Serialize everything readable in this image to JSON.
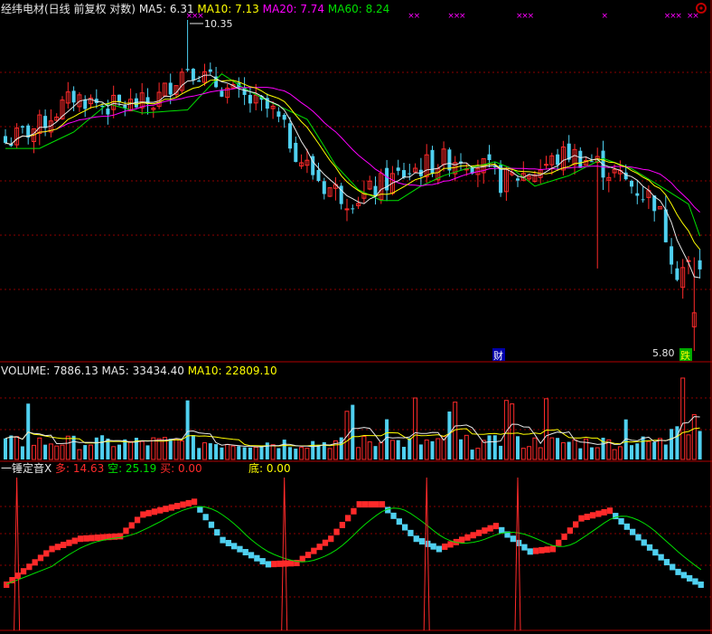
{
  "colors": {
    "background": "#000000",
    "up": "#ff2a2a",
    "down": "#4fd0f0",
    "ma5": "#e8e8e8",
    "ma10": "#ffff00",
    "ma20": "#ff00ff",
    "ma60": "#00e000",
    "grid": "#8b0000",
    "panel_border": "#b00000",
    "trade_fill": "#0000aa"
  },
  "main_panel": {
    "title": "经纬电材(日线 前复权 对数)",
    "legend": [
      {
        "label": "MA5",
        "value": "6.31",
        "color": "#e8e8e8"
      },
      {
        "label": "MA10",
        "value": "7.13",
        "color": "#ffff00"
      },
      {
        "label": "MA20",
        "value": "7.74",
        "color": "#ff00ff"
      },
      {
        "label": "MA60",
        "value": "8.24",
        "color": "#00e000"
      }
    ],
    "high_label": "10.35",
    "low_label": "5.80",
    "markers": [
      {
        "text": "财",
        "kind": "event"
      },
      {
        "text": "跌",
        "kind": "event"
      }
    ],
    "corner_icon": "gear-icon"
  },
  "volume_panel": {
    "legend": [
      {
        "label": "VOLUME",
        "value": "7886.13",
        "color": "#e8e8e8"
      },
      {
        "label": "MA5",
        "value": "33434.40",
        "color": "#e8e8e8"
      },
      {
        "label": "MA10",
        "value": "22809.10",
        "color": "#ffff00"
      }
    ]
  },
  "indicator_panel": {
    "name": "一锤定音X",
    "legend": [
      {
        "label": "多",
        "value": "14.63",
        "color": "#ff2a2a"
      },
      {
        "label": "空",
        "value": "25.19",
        "color": "#00e000"
      },
      {
        "label": "买",
        "value": "0.00",
        "color": "#ff2a2a"
      },
      {
        "label": "底",
        "value": "0.00",
        "color": "#ffff00"
      }
    ]
  },
  "chart_data": {
    "type": "candlestick",
    "title": "经纬电材(日线 前复权 对数)",
    "y_scale": "log",
    "price_high": 10.35,
    "price_low": 5.8,
    "n": 123,
    "close_path": [
      [
        0,
        8.35
      ],
      [
        6,
        8.6
      ],
      [
        12,
        9.05
      ],
      [
        18,
        8.9
      ],
      [
        26,
        8.95
      ],
      [
        32,
        9.55
      ],
      [
        36,
        9.3
      ],
      [
        40,
        9.1
      ],
      [
        47,
        8.8
      ],
      [
        52,
        8.1
      ],
      [
        56,
        7.75
      ],
      [
        60,
        7.6
      ],
      [
        63,
        7.6
      ],
      [
        67,
        7.8
      ],
      [
        71,
        7.95
      ],
      [
        75,
        8.05
      ],
      [
        80,
        8.15
      ],
      [
        83,
        8.05
      ],
      [
        87,
        7.8
      ],
      [
        93,
        7.95
      ],
      [
        99,
        8.2
      ],
      [
        104,
        8.05
      ],
      [
        108,
        7.85
      ],
      [
        114,
        7.55
      ],
      [
        118,
        6.7
      ],
      [
        122,
        6.75
      ]
    ],
    "volume_ma5": 33434.4,
    "volume_ma10": 22809.1,
    "volume_last": 7886.13,
    "indicator": {
      "多": 14.63,
      "空": 25.19,
      "买": 0.0,
      "底": 0.0
    }
  }
}
